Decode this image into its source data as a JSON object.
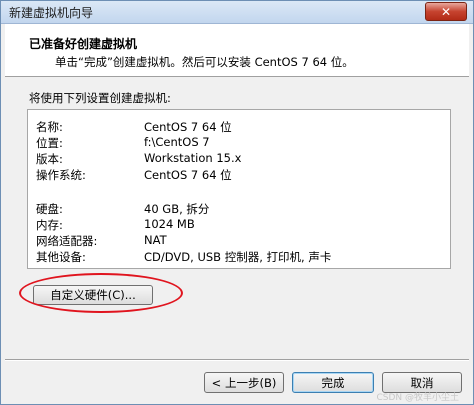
{
  "window": {
    "title": "新建虚拟机向导",
    "close_label": "✕"
  },
  "header": {
    "title": "已准备好创建虚拟机",
    "subtitle": "单击“完成”创建虚拟机。然后可以安装 CentOS 7 64 位。"
  },
  "intro": "将使用下列设置创建虚拟机:",
  "summary": {
    "rows": [
      {
        "label": "名称:",
        "value": "CentOS 7 64 位"
      },
      {
        "label": "位置:",
        "value": "f:\\CentOS 7"
      },
      {
        "label": "版本:",
        "value": "Workstation 15.x"
      },
      {
        "label": "操作系统:",
        "value": "CentOS 7 64 位"
      },
      {
        "label": "硬盘:",
        "value": "40 GB, 拆分"
      },
      {
        "label": "内存:",
        "value": "1024 MB"
      },
      {
        "label": "网络适配器:",
        "value": "NAT"
      },
      {
        "label": "其他设备:",
        "value": "CD/DVD, USB 控制器, 打印机, 声卡"
      }
    ]
  },
  "customize_button": "自定义硬件(C)...",
  "footer": {
    "back_label": "< 上一步(B)",
    "finish_label": "完成",
    "cancel_label": "取消"
  },
  "watermark": "CSDN @牧羊小尘土"
}
